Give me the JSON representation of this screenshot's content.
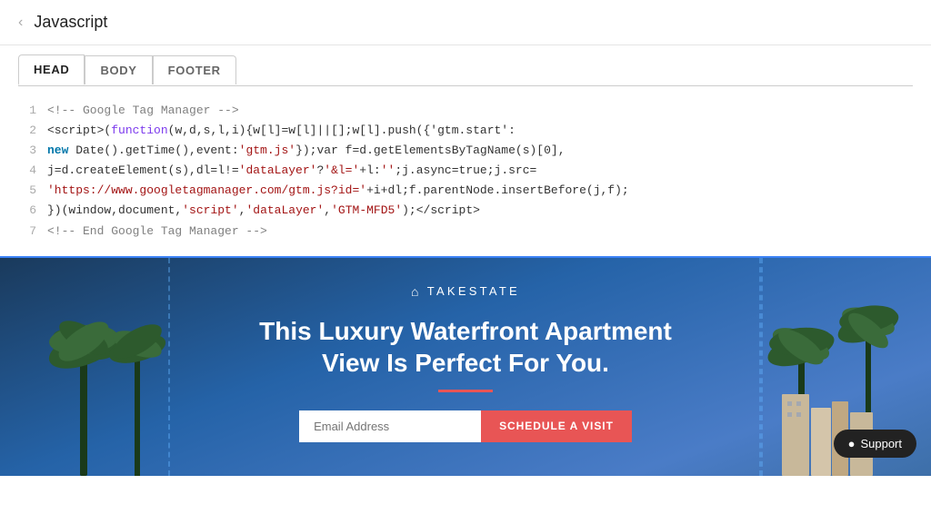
{
  "header": {
    "back_label": "‹",
    "title": "Javascript"
  },
  "tabs": {
    "items": [
      {
        "id": "head",
        "label": "HEAD",
        "active": true
      },
      {
        "id": "body",
        "label": "BODY",
        "active": false
      },
      {
        "id": "footer",
        "label": "FOOTER",
        "active": false
      }
    ]
  },
  "code": {
    "lines": [
      {
        "num": "1",
        "html_content": "comment_start"
      },
      {
        "num": "2",
        "html_content": "line2"
      },
      {
        "num": "3",
        "html_content": "line3"
      },
      {
        "num": "4",
        "html_content": "line4"
      },
      {
        "num": "5",
        "html_content": "line5"
      },
      {
        "num": "6",
        "html_content": "line6"
      },
      {
        "num": "7",
        "html_content": "comment_end"
      }
    ]
  },
  "preview": {
    "logo_icon": "⌂",
    "logo_text": "TAKESTATE",
    "headline": "This Luxury Waterfront Apartment View Is Perfect For You.",
    "email_placeholder": "Email Address",
    "cta_button": "SCHEDULE A VISIT",
    "support_button": "Support"
  }
}
